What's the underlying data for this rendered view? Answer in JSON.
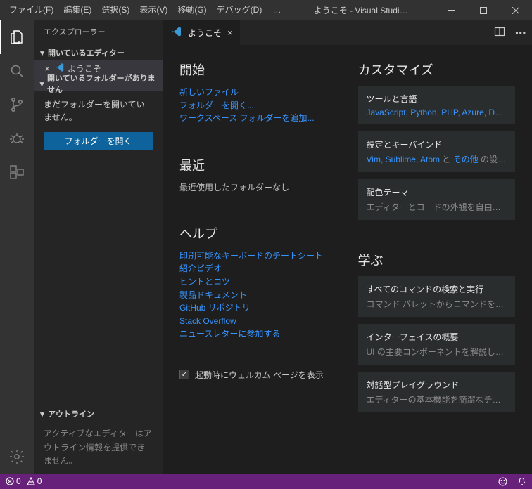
{
  "titlebar": {
    "menus": [
      "ファイル(F)",
      "編集(E)",
      "選択(S)",
      "表示(V)",
      "移動(G)",
      "デバッグ(D)"
    ],
    "overflow": "…",
    "title": "ようこそ - Visual Studi…"
  },
  "activitybar": {
    "items": [
      "explorer",
      "search",
      "scm",
      "debug",
      "extensions"
    ],
    "bottom": "settings"
  },
  "sidebar": {
    "title": "エクスプローラー",
    "open_editors": {
      "label": "開いているエディター",
      "item": "ようこそ"
    },
    "no_folder_section": {
      "label": "開いているフォルダーがありません",
      "message": "まだフォルダーを開いていません。",
      "button": "フォルダーを開く"
    },
    "outline": {
      "label": "アウトライン",
      "message": "アクティブなエディターはアウトライン情報を提供できません。"
    }
  },
  "tab": {
    "label": "ようこそ"
  },
  "welcome": {
    "start": {
      "heading": "開始",
      "links": [
        "新しいファイル",
        "フォルダーを開く...",
        "ワークスペース フォルダーを追加..."
      ]
    },
    "recent": {
      "heading": "最近",
      "empty": "最近使用したフォルダーなし"
    },
    "help": {
      "heading": "ヘルプ",
      "links": [
        "印刷可能なキーボードのチートシート",
        "紹介ビデオ",
        "ヒントとコツ",
        "製品ドキュメント",
        "GitHub リポジトリ",
        "Stack Overflow",
        "ニュースレターに参加する"
      ]
    },
    "startup_checkbox": "起動時にウェルカム ページを表示",
    "customize": {
      "heading": "カスタマイズ",
      "cards": [
        {
          "title": "ツールと言語",
          "links": [
            "JavaScript",
            "Python",
            "PHP",
            "Azure",
            "Doc…"
          ],
          "sep": ", "
        },
        {
          "title": "設定とキーバインド",
          "prefix_links": [
            "Vim",
            "Sublime",
            "Atom"
          ],
          "mid": " と ",
          "post_link": "その他",
          "suffix": " の設定…"
        },
        {
          "title": "配色テーマ",
          "text": "エディターとコードの外観を自由に設定し…"
        }
      ]
    },
    "learn": {
      "heading": "学ぶ",
      "cards": [
        {
          "title": "すべてのコマンドの検索と実行",
          "text": "コマンド パレットからコマンドを検索してす…"
        },
        {
          "title": "インターフェイスの概要",
          "text": "UI の主要コンポーネントを解説した視覚…"
        },
        {
          "title": "対話型プレイグラウンド",
          "text": "エディターの基本機能を簡潔なチュートリ…"
        }
      ]
    }
  },
  "statusbar": {
    "errors": "0",
    "warnings": "0"
  }
}
